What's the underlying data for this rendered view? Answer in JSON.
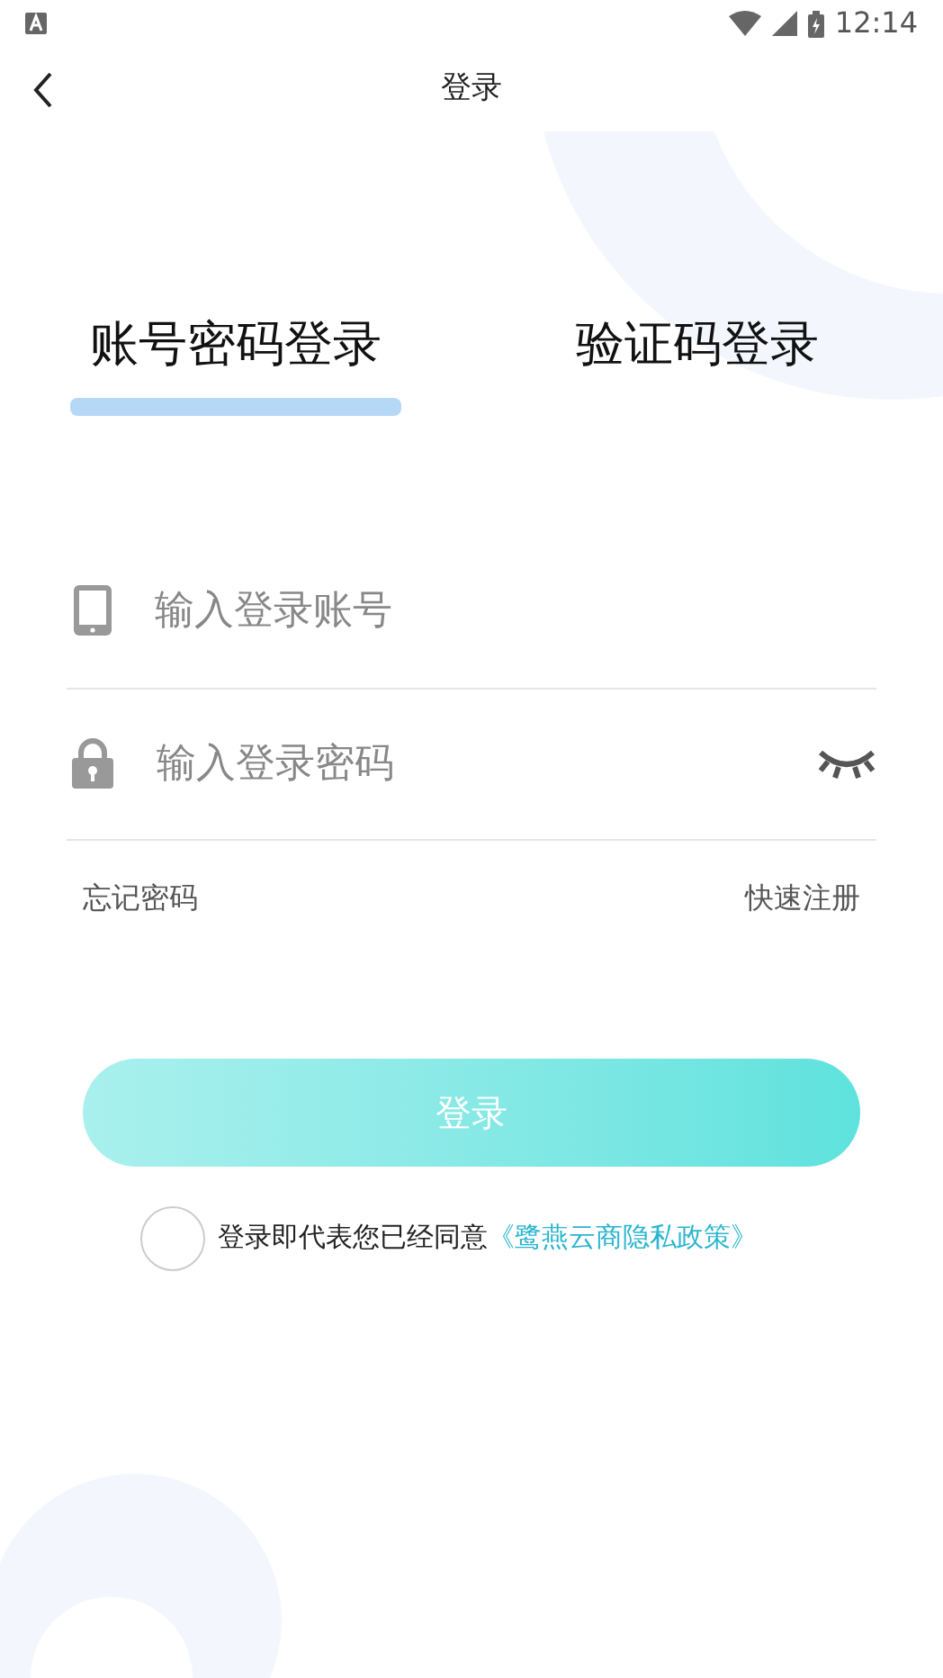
{
  "status_bar": {
    "time": "12:14"
  },
  "header": {
    "title": "登录"
  },
  "tabs": [
    {
      "label": "账号密码登录",
      "selected": true
    },
    {
      "label": "验证码登录",
      "selected": false
    }
  ],
  "fields": [
    {
      "kind": "phone",
      "placeholder": "输入登录账号"
    },
    {
      "kind": "password",
      "placeholder": "输入登录密码",
      "password_visible": false
    }
  ],
  "links": {
    "forgot": "忘记密码",
    "register": "快速注册"
  },
  "login_button": {
    "label": "登录"
  },
  "agreement": {
    "checked": false,
    "text": "登录即代表您已经同意",
    "link": "《鹭燕云商隐私政策》"
  }
}
